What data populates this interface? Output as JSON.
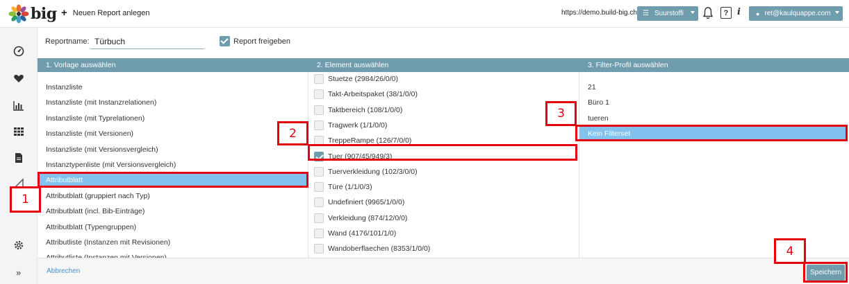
{
  "topbar": {
    "brand": "big",
    "new_report": "Neuen Report anlegen",
    "url": "https://demo.build-big.ch",
    "project": "Suurstoffi",
    "user": "ret@kaulquappe.com"
  },
  "sidebar": {
    "icons": [
      "dashboard-icon",
      "heart-icon",
      "bar-chart-icon",
      "grid-icon",
      "document-icon",
      "ruler-icon",
      "gear-icon",
      "expand-icon"
    ]
  },
  "form": {
    "name_label": "Reportname:",
    "name_value": "Türbuch",
    "share_label": "Report freigeben",
    "share_checked": true
  },
  "columns": {
    "templates_header": "1. Vorlage auswählen",
    "elements_header": "2. Element auswählen",
    "filters_header": "3. Filter-Profil auswählen"
  },
  "templates": [
    {
      "label": "Instanzliste",
      "selected": false
    },
    {
      "label": "Instanzliste (mit Instanzrelationen)",
      "selected": false
    },
    {
      "label": "Instanzliste (mit Typrelationen)",
      "selected": false
    },
    {
      "label": "Instanzliste (mit Versionen)",
      "selected": false
    },
    {
      "label": "Instanzliste (mit Versionsvergleich)",
      "selected": false
    },
    {
      "label": "Instanztypenliste (mit Versionsvergleich)",
      "selected": false
    },
    {
      "label": "Attributblatt",
      "selected": true
    },
    {
      "label": "Attributblatt (gruppiert nach Typ)",
      "selected": false
    },
    {
      "label": "Attributblatt (incl. Bib-Einträge)",
      "selected": false
    },
    {
      "label": "Attributblatt (Typengruppen)",
      "selected": false
    },
    {
      "label": "Attributliste (Instanzen mit Revisionen)",
      "selected": false
    },
    {
      "label": "Attributliste (Instanzen mit Versionen)",
      "selected": false
    }
  ],
  "elements": [
    {
      "label": "Stuetze (2984/26/0/0)",
      "checked": false
    },
    {
      "label": "Takt-Arbeitspaket (38/1/0/0)",
      "checked": false
    },
    {
      "label": "Taktbereich (108/1/0/0)",
      "checked": false
    },
    {
      "label": "Tragwerk (1/1/0/0)",
      "checked": false
    },
    {
      "label": "TreppeRampe (126/7/0/0)",
      "checked": false
    },
    {
      "label": "Tuer (907/45/949/3)",
      "checked": true
    },
    {
      "label": "Tuerverkleidung (102/3/0/0)",
      "checked": false
    },
    {
      "label": "Türe (1/1/0/3)",
      "checked": false
    },
    {
      "label": "Undefiniert (9965/1/0/0)",
      "checked": false
    },
    {
      "label": "Verkleidung (874/12/0/0)",
      "checked": false
    },
    {
      "label": "Wand (4176/101/1/0)",
      "checked": false
    },
    {
      "label": "Wandoberflaechen (8353/1/0/0)",
      "checked": false
    }
  ],
  "filters": [
    {
      "label": "21",
      "selected": false
    },
    {
      "label": "Büro 1",
      "selected": false
    },
    {
      "label": "tueren",
      "selected": false
    },
    {
      "label": "Kein Filterset",
      "selected": true
    }
  ],
  "footer": {
    "cancel": "Abbrechen",
    "save": "Speichern"
  },
  "annotations": [
    "1",
    "2",
    "3",
    "4"
  ],
  "colors": {
    "accent": "#6f9dad",
    "selection": "#83c1ee",
    "callout": "#e3000f"
  }
}
